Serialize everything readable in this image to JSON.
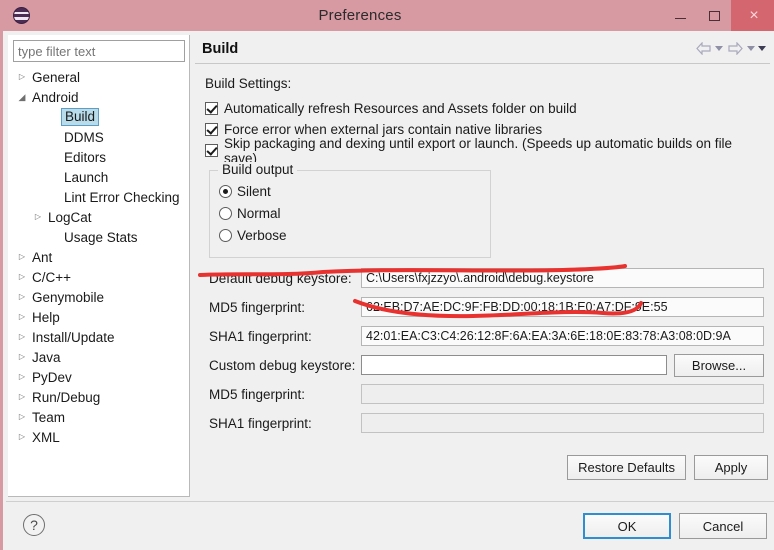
{
  "window": {
    "title": "Preferences",
    "app_icon": "eclipse-icon",
    "controls": {
      "minimize": "minimize-icon",
      "maximize": "maximize-icon",
      "close": "×"
    }
  },
  "sidebar": {
    "filter": {
      "placeholder": "type filter text",
      "value": ""
    },
    "tree": [
      {
        "label": "General",
        "depth": 0,
        "twist": "closed",
        "selected": false
      },
      {
        "label": "Android",
        "depth": 0,
        "twist": "open",
        "selected": false
      },
      {
        "label": "Build",
        "depth": 2,
        "twist": "none",
        "selected": true
      },
      {
        "label": "DDMS",
        "depth": 2,
        "twist": "none",
        "selected": false
      },
      {
        "label": "Editors",
        "depth": 2,
        "twist": "none",
        "selected": false
      },
      {
        "label": "Launch",
        "depth": 2,
        "twist": "none",
        "selected": false
      },
      {
        "label": "Lint Error Checking",
        "depth": 2,
        "twist": "none",
        "selected": false
      },
      {
        "label": "LogCat",
        "depth": 1,
        "twist": "closed",
        "selected": false
      },
      {
        "label": "Usage Stats",
        "depth": 2,
        "twist": "none",
        "selected": false
      },
      {
        "label": "Ant",
        "depth": 0,
        "twist": "closed",
        "selected": false
      },
      {
        "label": "C/C++",
        "depth": 0,
        "twist": "closed",
        "selected": false
      },
      {
        "label": "Genymobile",
        "depth": 0,
        "twist": "closed",
        "selected": false
      },
      {
        "label": "Help",
        "depth": 0,
        "twist": "closed",
        "selected": false
      },
      {
        "label": "Install/Update",
        "depth": 0,
        "twist": "closed",
        "selected": false
      },
      {
        "label": "Java",
        "depth": 0,
        "twist": "closed",
        "selected": false
      },
      {
        "label": "PyDev",
        "depth": 0,
        "twist": "closed",
        "selected": false
      },
      {
        "label": "Run/Debug",
        "depth": 0,
        "twist": "closed",
        "selected": false
      },
      {
        "label": "Team",
        "depth": 0,
        "twist": "closed",
        "selected": false
      },
      {
        "label": "XML",
        "depth": 0,
        "twist": "closed",
        "selected": false
      }
    ]
  },
  "page": {
    "title": "Build",
    "nav": {
      "back": "back-arrow-icon",
      "back_menu": "chevron-down-icon",
      "forward": "forward-arrow-icon",
      "forward_menu": "chevron-down-icon",
      "view_menu": "chevron-down-icon"
    },
    "settings_label": "Build Settings:",
    "checkboxes": [
      {
        "label": "Automatically refresh Resources and Assets folder on build",
        "checked": true
      },
      {
        "label": "Force error when external jars contain native libraries",
        "checked": true
      },
      {
        "label": "Skip packaging and dexing until export or launch. (Speeds up automatic builds on file save)",
        "checked": true
      }
    ],
    "build_output": {
      "legend": "Build output",
      "options": [
        {
          "label": "Silent",
          "selected": true
        },
        {
          "label": "Normal",
          "selected": false
        },
        {
          "label": "Verbose",
          "selected": false
        }
      ]
    },
    "fields": [
      {
        "label": "Default debug keystore:",
        "value": "C:\\Users\\fxjzzyo\\.android\\debug.keystore",
        "readonly": true,
        "browse": null
      },
      {
        "label": "MD5 fingerprint:",
        "value": "62:EB:D7:AE:DC:9F:FB:DD:00:18:1B:E0:A7:DF:9E:55",
        "readonly": true,
        "browse": null
      },
      {
        "label": "SHA1 fingerprint:",
        "value": "42:01:EA:C3:C4:26:12:8F:6A:EA:3A:6E:18:0E:83:78:A3:08:0D:9A",
        "readonly": true,
        "browse": null
      },
      {
        "label": "Custom debug keystore:",
        "value": "",
        "readonly": false,
        "browse": "Browse..."
      },
      {
        "label": "MD5 fingerprint:",
        "value": "",
        "readonly": true,
        "browse": null
      },
      {
        "label": "SHA1 fingerprint:",
        "value": "",
        "readonly": true,
        "browse": null
      }
    ],
    "buttons": {
      "restore_defaults": "Restore Defaults",
      "apply": "Apply"
    }
  },
  "footer": {
    "help": "?",
    "ok": "OK",
    "cancel": "Cancel"
  },
  "annotations": {
    "color": "#e8322f",
    "marks": [
      "underline-default-debug-keystore-label",
      "underline-md5-fingerprint-value"
    ]
  },
  "colors": {
    "titlebar": "#d79aa3",
    "close_button": "#d4666f",
    "selection": "#b8dcea",
    "selection_border": "#5f9ec4",
    "default_button_border": "#2f8ecf",
    "annotation_red": "#e8322f",
    "dialog_bg": "#f0f0f0"
  }
}
